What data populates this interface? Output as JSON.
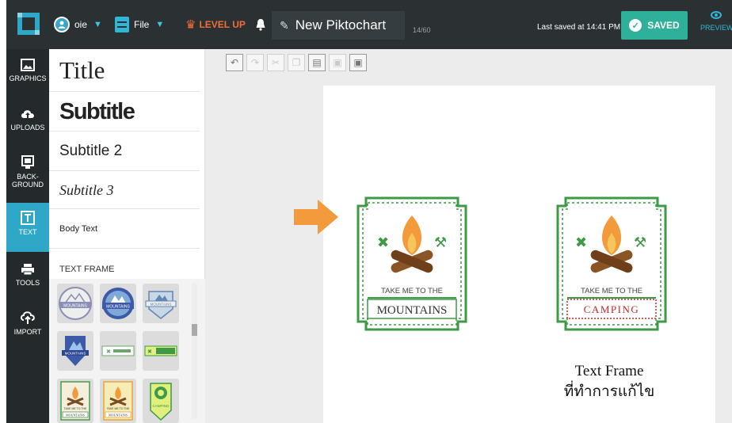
{
  "topbar": {
    "user_name": "oie",
    "file_label": "File",
    "levelup_label": "LEVEL UP",
    "doc_title": "New Piktochart",
    "char_count": "14/60",
    "last_saved": "Last saved at 14:41 PM",
    "saved_label": "SAVED",
    "preview_label": "PREVIEW"
  },
  "nav": [
    {
      "label": "GRAPHICS",
      "icon": "image-icon"
    },
    {
      "label": "UPLOADS",
      "icon": "cloud-upload-icon"
    },
    {
      "label": "BACK-GROUND",
      "icon": "monitor-icon"
    },
    {
      "label": "TEXT",
      "icon": "text-icon"
    },
    {
      "label": "TOOLS",
      "icon": "printer-icon"
    },
    {
      "label": "IMPORT",
      "icon": "cloud-import-icon"
    }
  ],
  "text_panel": {
    "title": "Title",
    "subtitle": "Subtitle",
    "subtitle2": "Subtitle 2",
    "subtitle3": "Subtitle 3",
    "body": "Body Text",
    "section": "TEXT FRAME"
  },
  "badges": {
    "left": {
      "top": "TAKE ME TO THE",
      "bottom": "MOUNTAINS"
    },
    "right": {
      "top": "TAKE ME TO THE",
      "bottom": "CAMPING"
    }
  },
  "thumb_labels": {
    "mountains": "MOUNTAINS",
    "camping": "CAMPING",
    "take_me": "TAKE ME TO THE"
  },
  "caption": {
    "line1": "Text Frame",
    "line2": "ที่ทำการแก้ไข"
  },
  "colors": {
    "accent": "#2fa7c7",
    "green": "#3e9a46",
    "orange": "#f39a3c",
    "red": "#c8262a"
  }
}
